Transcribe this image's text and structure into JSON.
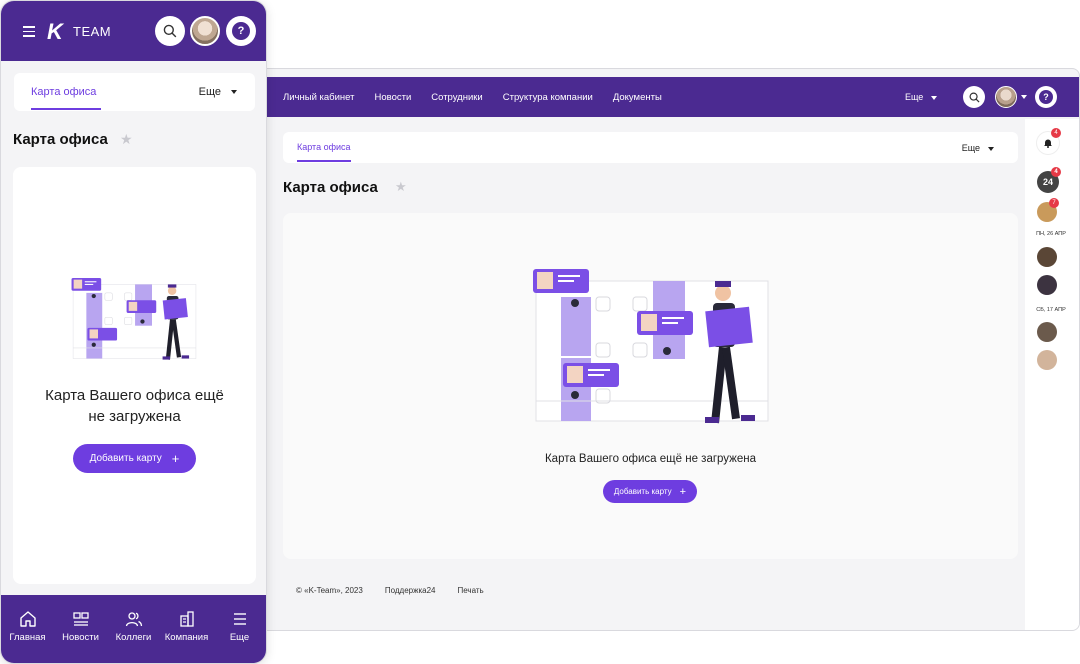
{
  "desktop": {
    "nav": {
      "links": [
        "Личный кабинет",
        "Новости",
        "Сотрудники",
        "Структура компании",
        "Документы"
      ],
      "more": "Еще"
    },
    "tabs": {
      "active": "Карта офиса",
      "more": "Еще"
    },
    "title": "Карта офиса",
    "empty_text": "Карта Вашего офиса ещё не загружена",
    "add_button": "Добавить карту",
    "footer": {
      "copyright": "© «K-Team», 2023",
      "support": "Поддержка24",
      "print": "Печать"
    },
    "right_panel": {
      "bell_badge": "4",
      "chat24_label": "24",
      "chat24_badge": "4",
      "user_badge": "7",
      "date1": "ПН, 26 АПР",
      "date2": "СБ, 17 АПР"
    }
  },
  "mobile": {
    "brand_letter": "K",
    "brand_name": "TEAM",
    "tabs": {
      "active": "Карта офиса",
      "more": "Еще"
    },
    "title": "Карта офиса",
    "empty_line1": "Карта Вашего офиса ещё",
    "empty_line2": "не загружена",
    "add_button": "Добавить карту",
    "bottom_nav": [
      {
        "label": "Главная",
        "icon": "home-icon"
      },
      {
        "label": "Новости",
        "icon": "news-icon"
      },
      {
        "label": "Коллеги",
        "icon": "people-icon"
      },
      {
        "label": "Компания",
        "icon": "building-icon"
      },
      {
        "label": "Еще",
        "icon": "menu-icon"
      }
    ]
  },
  "colors": {
    "brand": "#4b2a91",
    "accent": "#6e3de0",
    "badge": "#e63946"
  }
}
